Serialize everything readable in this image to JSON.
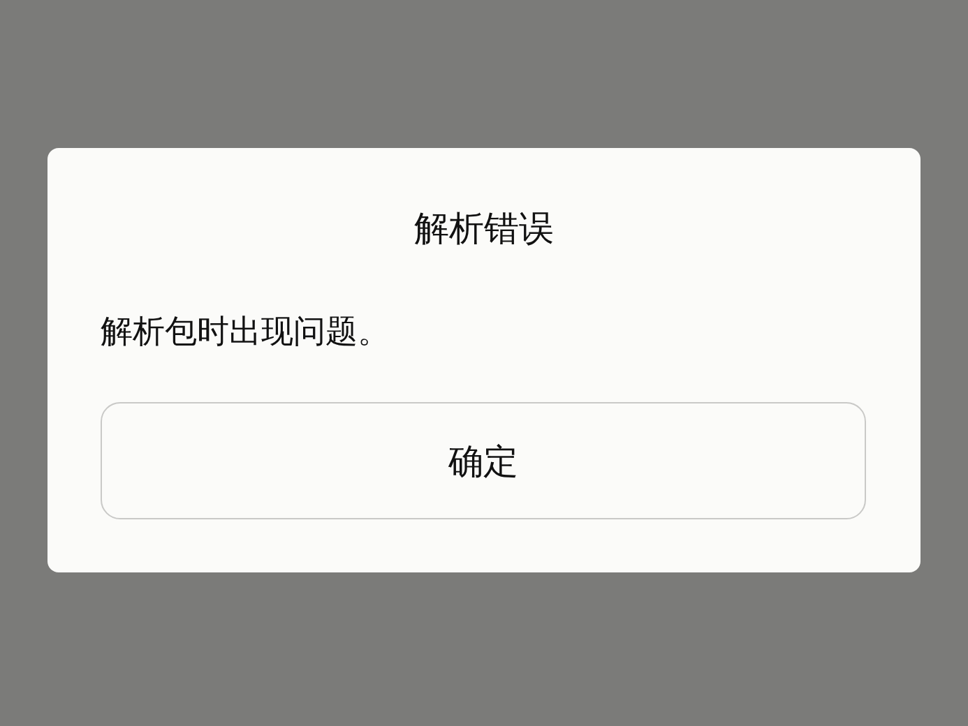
{
  "dialog": {
    "title": "解析错误",
    "message": "解析包时出现问题。",
    "buttons": [
      "确定"
    ]
  }
}
